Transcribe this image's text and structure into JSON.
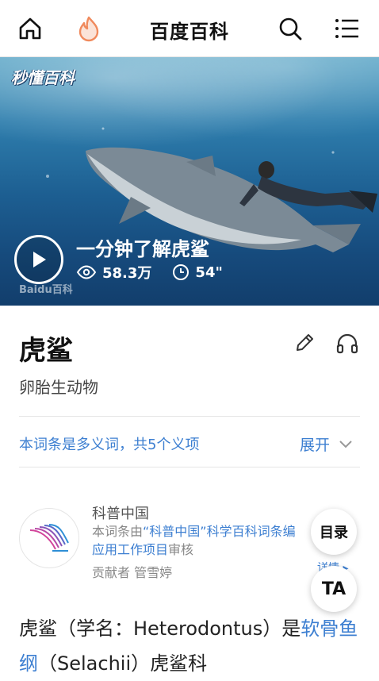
{
  "header": {
    "title": "百度百科",
    "icons": [
      "home-icon",
      "flame-icon",
      "search-icon",
      "menu-icon"
    ]
  },
  "hero": {
    "logo_text": "秒懂百科",
    "watermark": "Baidu百科",
    "video_title": "一分钟了解虎鲨",
    "views": "58.3万",
    "duration": "54\""
  },
  "entry": {
    "title": "虎鲨",
    "subtitle": "卵胎生动物"
  },
  "polysemy": {
    "text": "本词条是多义词，共5个义项",
    "expand_label": "展开"
  },
  "contributor": {
    "name": "科普中国",
    "desc_prefix": "本词条由",
    "desc_highlight": "“科普中国”科学百科词条编",
    "desc_link2": "应用工作项目",
    "desc_suffix": "审核",
    "by": "贡献者  管雪婷",
    "more_peek": "详情 ▸"
  },
  "floating": {
    "toc_label": "目录",
    "ta_label": "TA"
  },
  "body": {
    "text1": "虎鲨（学名：Heterodontus）是",
    "link1": "软骨鱼纲",
    "text2": "（Selachii）虎鲨科"
  },
  "colors": {
    "link": "#3d7fd1",
    "flame": "#f08a5d"
  }
}
